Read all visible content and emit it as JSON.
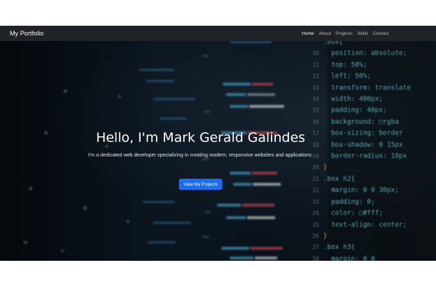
{
  "navbar": {
    "brand": "My Portfolio",
    "links": [
      {
        "label": "Home",
        "active": true
      },
      {
        "label": "About",
        "active": false
      },
      {
        "label": "Projects",
        "active": false
      },
      {
        "label": "Skills",
        "active": false
      },
      {
        "label": "Contact",
        "active": false
      }
    ]
  },
  "hero": {
    "title": "Hello, I'm Mark Gerald Galindes",
    "subtitle": "I'm a dedicated web developer specializing in creating modern, responsive websites and applications.",
    "cta_label": "View My Projects"
  },
  "colors": {
    "navbar_bg": "#1f2226",
    "cta_bg": "#1b6ef0",
    "code_cyan": "#6ad0d8",
    "code_yellow": "#e6c84a"
  }
}
